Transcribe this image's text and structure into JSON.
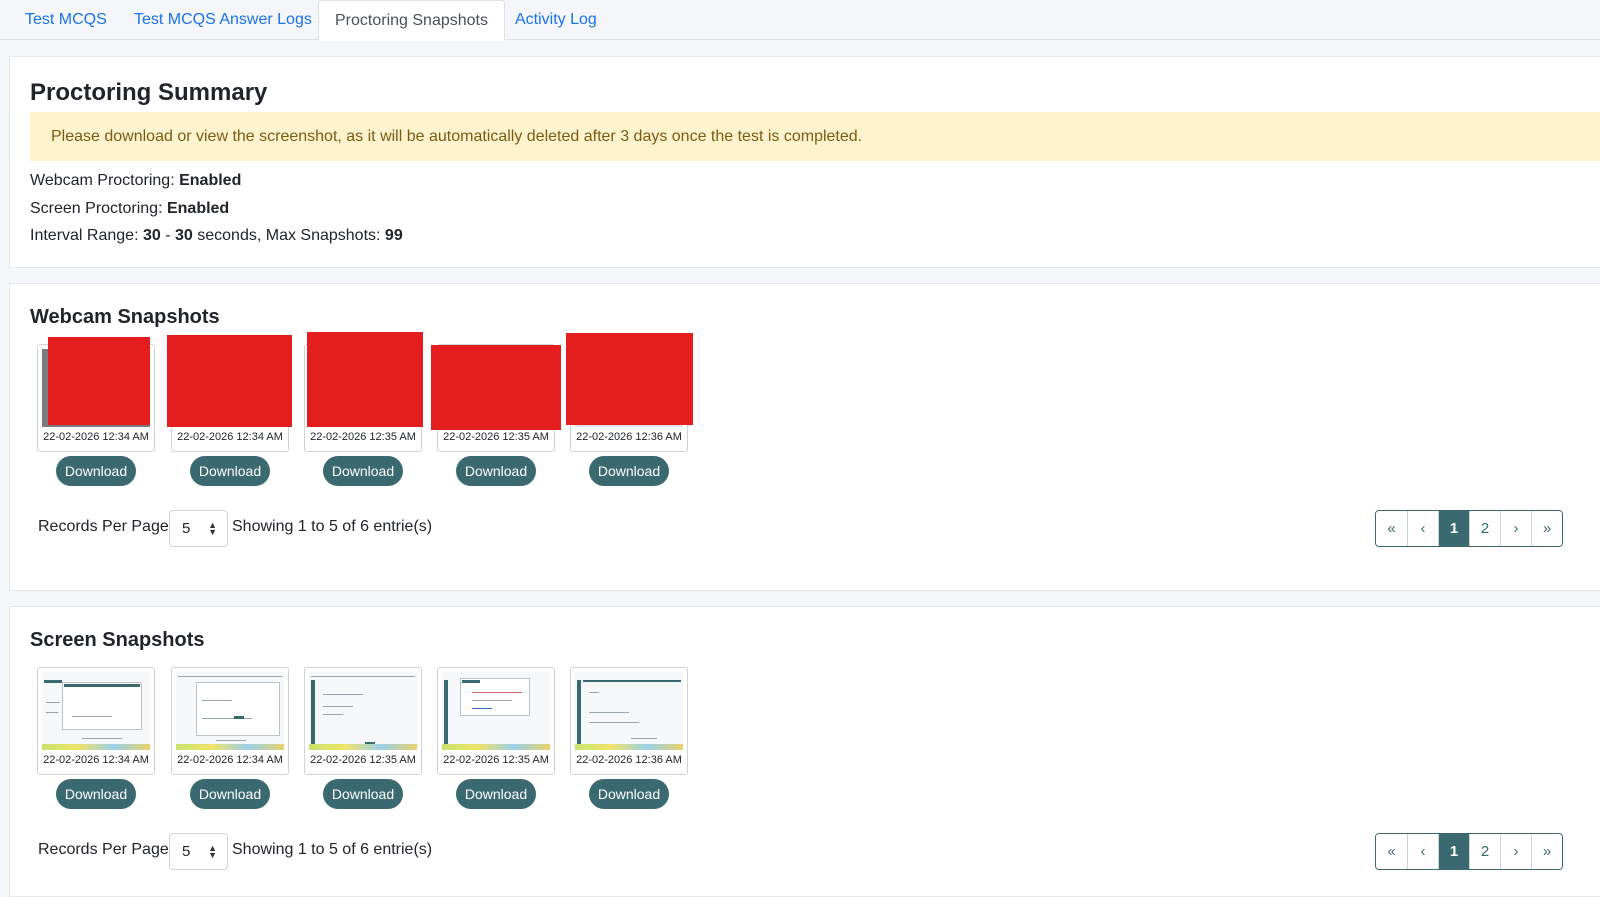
{
  "tabs": [
    {
      "label": "Test MCQS"
    },
    {
      "label": "Test MCQS Answer Logs"
    },
    {
      "label": "Proctoring Snapshots",
      "active": true
    },
    {
      "label": "Activity Log"
    }
  ],
  "summary": {
    "title": "Proctoring Summary",
    "alert": "Please download or view the screenshot, as it will be automatically deleted after 3 days once the test is completed.",
    "webcam_label": "Webcam Proctoring:",
    "webcam_value": "Enabled",
    "screen_label": "Screen Proctoring:",
    "screen_value": "Enabled",
    "interval_label": "Interval Range:",
    "interval_min": "30",
    "interval_sep": "-",
    "interval_max": "30",
    "interval_unit": "seconds, Max Snapshots:",
    "max_snapshots": "99"
  },
  "webcam": {
    "title": "Webcam Snapshots",
    "snapshots": [
      {
        "time": "22-02-2026 12:34 AM"
      },
      {
        "time": "22-02-2026 12:34 AM"
      },
      {
        "time": "22-02-2026 12:35 AM"
      },
      {
        "time": "22-02-2026 12:35 AM"
      },
      {
        "time": "22-02-2026 12:36 AM"
      }
    ],
    "download_label": "Download",
    "records_label": "Records Per Page :",
    "per_page": "5",
    "showing": "Showing 1 to 5 of 6 entrie(s)",
    "pager": [
      "«",
      "‹",
      "1",
      "2",
      "›",
      "»"
    ],
    "current_page": "1"
  },
  "screen": {
    "title": "Screen Snapshots",
    "snapshots": [
      {
        "time": "22-02-2026 12:34 AM"
      },
      {
        "time": "22-02-2026 12:34 AM"
      },
      {
        "time": "22-02-2026 12:35 AM"
      },
      {
        "time": "22-02-2026 12:35 AM"
      },
      {
        "time": "22-02-2026 12:36 AM"
      }
    ],
    "download_label": "Download",
    "records_label": "Records Per Page :",
    "per_page": "5",
    "showing": "Showing 1 to 5 of 6 entrie(s)",
    "pager": [
      "«",
      "‹",
      "1",
      "2",
      "›",
      "»"
    ],
    "current_page": "1"
  },
  "colors": {
    "link": "#1a73e8",
    "accent": "#3a6a6f",
    "alert_bg": "#fff3cd",
    "redaction": "#e41e1e"
  }
}
